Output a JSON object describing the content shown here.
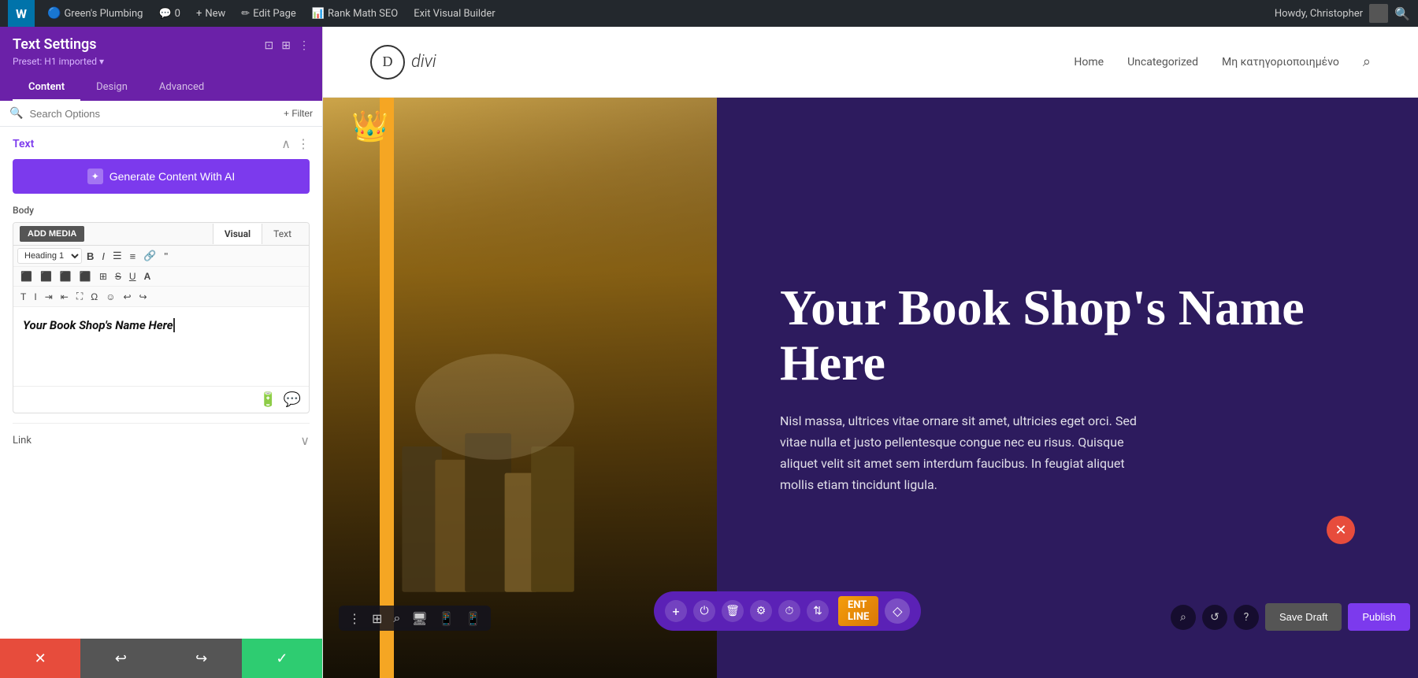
{
  "topbar": {
    "wordpress_icon": "W",
    "site_name": "Green's Plumbing",
    "comments": "0",
    "new_label": "New",
    "edit_page_label": "Edit Page",
    "rank_math_label": "Rank Math SEO",
    "exit_builder_label": "Exit Visual Builder",
    "howdy_text": "Howdy, Christopher"
  },
  "panel": {
    "title": "Text Settings",
    "preset": "Preset: H1 imported ▾",
    "tabs": [
      "Content",
      "Design",
      "Advanced"
    ],
    "active_tab": "Content",
    "search_placeholder": "Search Options",
    "filter_label": "+ Filter",
    "section_title": "Text",
    "ai_button_label": "Generate Content With AI",
    "body_label": "Body",
    "add_media_label": "ADD MEDIA",
    "editor_tabs": [
      "Visual",
      "Text"
    ],
    "active_editor_tab": "Visual",
    "heading_select": "Heading 1",
    "editor_content": "Your Book Shop's Name Here",
    "link_label": "Link",
    "bottom_buttons": {
      "cancel": "✕",
      "undo": "↩",
      "redo": "↪",
      "save": "✓"
    }
  },
  "site_header": {
    "logo_letter": "D",
    "logo_name": "divi",
    "nav_items": [
      "Home",
      "Uncategorized",
      "Μη κατηγοριοποιημένο"
    ]
  },
  "hero": {
    "title": "Your Book Shop's Name Here",
    "body_text": "Nisl massa, ultrices vitae ornare sit amet, ultricies eget orci. Sed vitae nulla et justo pellentesque congue nec eu risus. Quisque aliquet velit sit amet sem interdum faucibus. In feugiat aliquet mollis etiam tincidunt ligula."
  },
  "action_bar": {
    "icons": [
      "+",
      "⏻",
      "🗑",
      "⚙",
      "⏱",
      "⇅"
    ]
  },
  "save_bar": {
    "save_draft_label": "Save Draft",
    "publish_label": "Publish"
  },
  "builder_bar_icons": [
    "⋮",
    "⊞",
    "⌕",
    "▭",
    "▭",
    "▯"
  ]
}
